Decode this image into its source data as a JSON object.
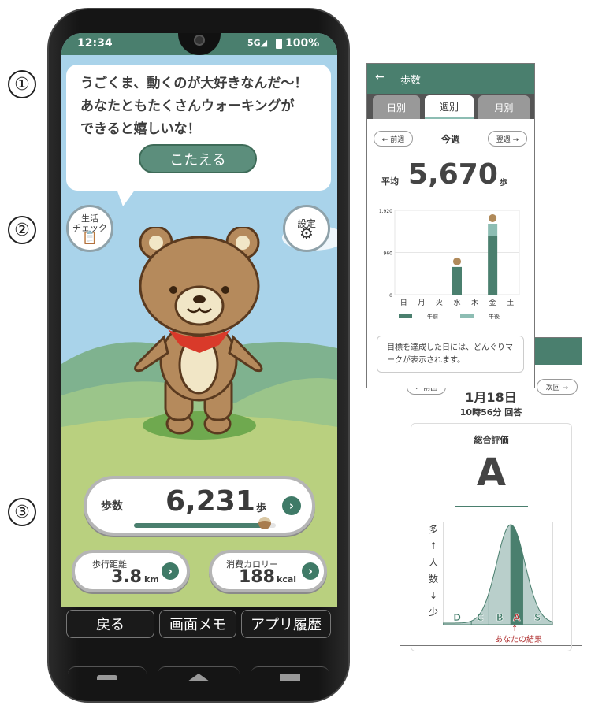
{
  "markers": [
    "①",
    "②",
    "③"
  ],
  "phone": {
    "status": {
      "time": "12:34",
      "network": "5G◢",
      "battery_icon": "battery-icon",
      "battery": "100%"
    },
    "bubble": {
      "message": "うごくま、動くのが大好きなんだ～！\nあなたともたくさんウォーキングが\nできると嬉しいな！",
      "answer_button": "こたえる"
    },
    "life_check": {
      "label_1": "生活",
      "label_2": "チェック"
    },
    "settings": {
      "label": "設定"
    },
    "steps": {
      "label": "歩数",
      "value": "6,231",
      "unit": "歩",
      "goal_progress": 0.93
    },
    "distance": {
      "label": "歩行距離",
      "value": "3.8",
      "unit": "km"
    },
    "calories": {
      "label": "消費カロリー",
      "value": "188",
      "unit": "kcal"
    },
    "nav": {
      "back": "戻る",
      "memo": "画面メモ",
      "history": "アプリ履歴"
    },
    "colors": {
      "accent": "#4a7f6e",
      "sky": "#a9d3ea",
      "ground": "#b9d07f"
    }
  },
  "weekly": {
    "title": "歩数",
    "tabs": [
      "日別",
      "週別",
      "月別"
    ],
    "active_tab": 1,
    "prev": "← 前週",
    "current": "今週",
    "next": "翌週 →",
    "avg_label": "平均",
    "avg_value": "5,670",
    "avg_unit": "歩",
    "note": "目標を達成した日には、どんぐりマークが表示されます。",
    "chart_data": {
      "type": "bar",
      "stacked": true,
      "categories": [
        "日",
        "月",
        "火",
        "水",
        "木",
        "金",
        "土"
      ],
      "yticks": [
        "0",
        "960",
        "1,920"
      ],
      "ylim": [
        0,
        1920
      ],
      "grid": true,
      "series": [
        {
          "name": "午前",
          "color": "#4a7f6e",
          "values": [
            0,
            0,
            0,
            630,
            0,
            1345,
            0
          ]
        },
        {
          "name": "午後",
          "color": "#8dbdb3",
          "values": [
            0,
            0,
            0,
            0,
            0,
            270,
            0
          ]
        }
      ],
      "goal_marks": [
        false,
        false,
        false,
        true,
        false,
        true,
        false
      ],
      "legend": "bottom"
    }
  },
  "result": {
    "prev": "← 前回",
    "next": "次回 →",
    "date": "1月18日",
    "time": "10時56分 回答",
    "overall_label": "総合評価",
    "grade": "A",
    "chart_data": {
      "type": "area",
      "grades": [
        "D",
        "C",
        "B",
        "A",
        "S"
      ],
      "highlight": "A",
      "y_axis": [
        "多",
        "↑",
        "人",
        "数",
        "↓",
        "少"
      ],
      "annotation": "あなたの結果"
    }
  }
}
